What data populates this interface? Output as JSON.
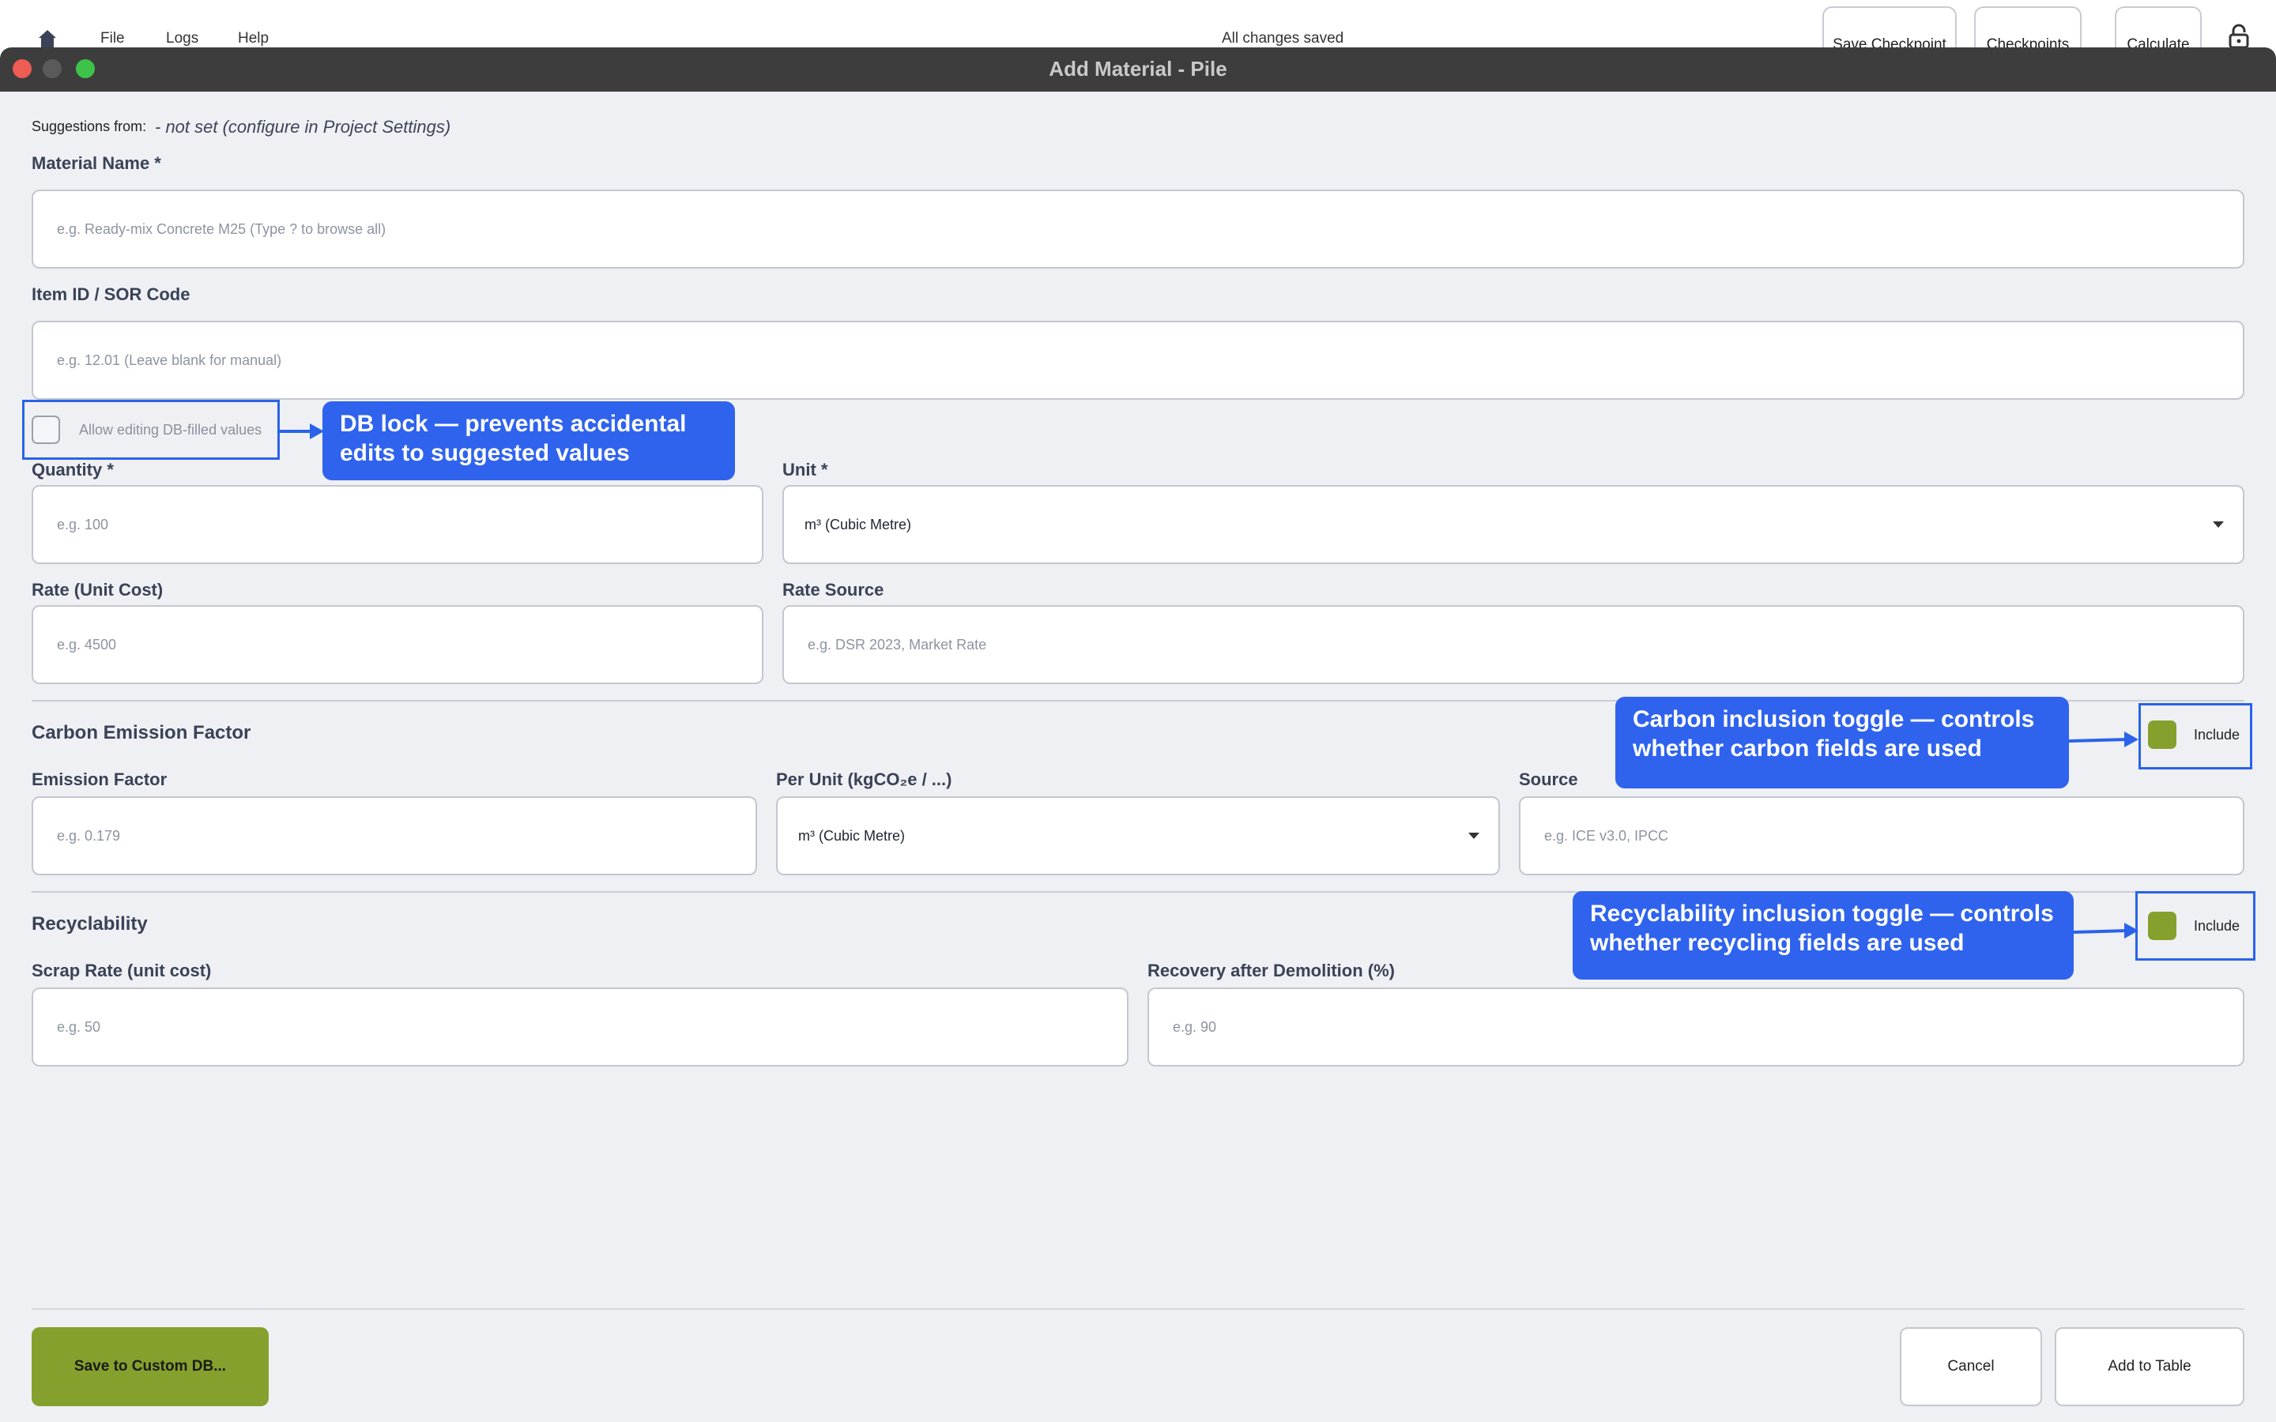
{
  "app": {
    "menu": [
      "File",
      "Logs",
      "Help"
    ],
    "status": "All changes saved",
    "buttons": {
      "save_checkpoint": "Save Checkpoint",
      "checkpoints": "Checkpoints",
      "calculate": "Calculate"
    },
    "icons": {
      "home": "home-icon",
      "lock": "lock-icon"
    }
  },
  "dialog": {
    "title": "Add Material - Pile",
    "suggestions_label": "Suggestions from:",
    "suggestions_value": "- not set (configure in Project Settings)",
    "material_name": {
      "label": "Material Name *",
      "placeholder": "e.g. Ready-mix Concrete M25  (Type ? to browse all)"
    },
    "item_id": {
      "label": "Item ID / SOR Code",
      "placeholder": "e.g. 12.01 (Leave blank for manual)"
    },
    "allow_editing": {
      "label": "Allow editing DB-filled values",
      "checked": false
    },
    "quantity": {
      "label": "Quantity *",
      "placeholder": "e.g. 100"
    },
    "unit": {
      "label": "Unit *",
      "value": "m³ (Cubic Metre)"
    },
    "rate": {
      "label": "Rate (Unit Cost)",
      "placeholder": "e.g. 4500"
    },
    "rate_source": {
      "label": "Rate Source",
      "placeholder": "e.g. DSR 2023, Market Rate"
    },
    "carbon": {
      "title": "Carbon Emission Factor",
      "include_label": "Include",
      "include_checked": true,
      "emission_factor": {
        "label": "Emission Factor",
        "placeholder": "e.g. 0.179"
      },
      "per_unit": {
        "label": "Per Unit  (kgCO₂e / ...)",
        "value": "m³ (Cubic Metre)"
      },
      "source": {
        "label": "Source",
        "placeholder": "e.g. ICE v3.0, IPCC"
      }
    },
    "recyclability": {
      "title": "Recyclability",
      "include_label": "Include",
      "include_checked": true,
      "scrap_rate": {
        "label": "Scrap Rate (unit cost)",
        "placeholder": "e.g. 50"
      },
      "recovery": {
        "label": "Recovery after Demolition (%)",
        "placeholder": "e.g. 90"
      }
    },
    "footer": {
      "save_custom": "Save to Custom DB...",
      "cancel": "Cancel",
      "add": "Add to Table"
    }
  },
  "annotations": {
    "db_lock": "DB lock — prevents accidental edits to suggested values",
    "carbon_toggle": "Carbon inclusion toggle — controls whether carbon fields are used",
    "recyclability_toggle": "Recyclability inclusion toggle — controls whether recycling fields are used"
  },
  "colors": {
    "accent_green": "#86a02d",
    "callout_blue": "#2f63ee",
    "titlebar": "#3d3d3d",
    "dialog_bg": "#eff0f4"
  }
}
